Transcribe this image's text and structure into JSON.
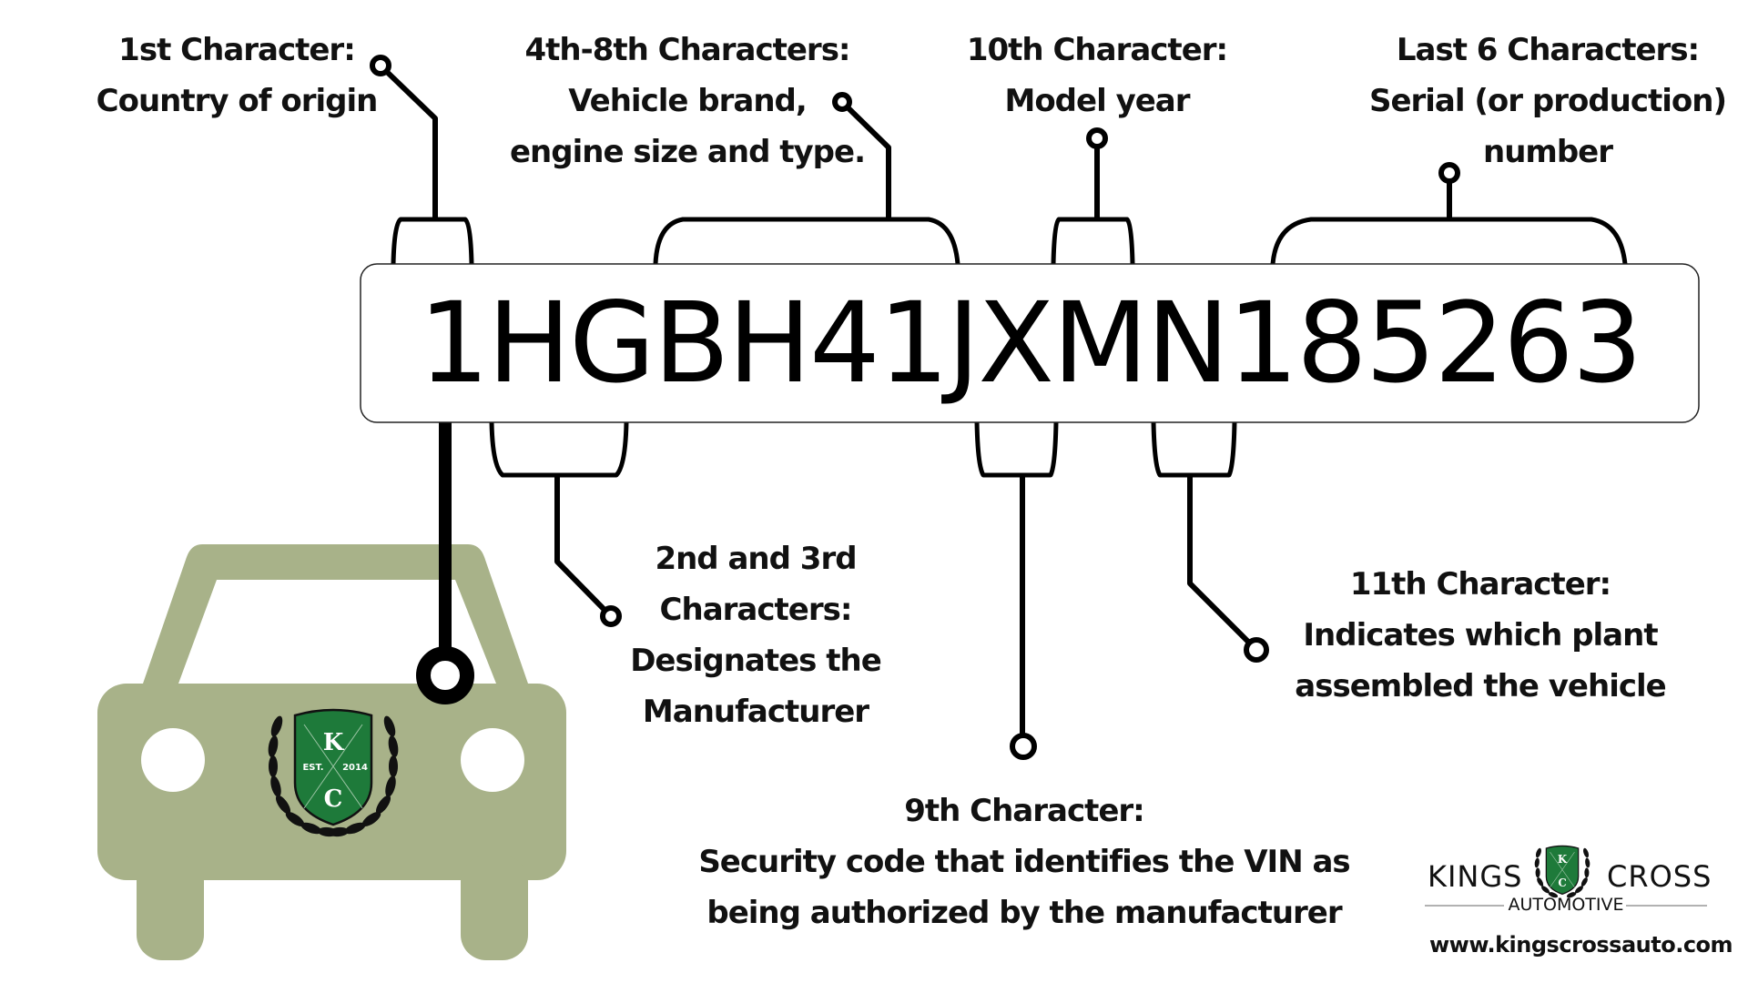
{
  "vin": "1HGBH41JXMN185263",
  "colors": {
    "car": "#a8b289",
    "shield_green": "#1e7a3a",
    "line": "#000000",
    "background": "#ffffff"
  },
  "annotations": {
    "first": {
      "title": "1st Character:",
      "lines": [
        "Country of origin"
      ]
    },
    "fourth_eighth": {
      "title": "4th-8th Characters:",
      "lines": [
        "Vehicle brand,",
        "engine size and type."
      ]
    },
    "tenth": {
      "title": "10th Character:",
      "lines": [
        "Model year"
      ]
    },
    "last_six": {
      "title": "Last 6 Characters:",
      "lines": [
        "Serial (or production)",
        "number"
      ]
    },
    "second_third": {
      "title": "2nd and 3rd",
      "lines": [
        "Characters:",
        "Designates the",
        "Manufacturer"
      ]
    },
    "ninth": {
      "title": "9th Character:",
      "lines": [
        "Security code that identifies the VIN as",
        "being authorized by the manufacturer"
      ]
    },
    "eleventh": {
      "title": "11th Character:",
      "lines": [
        "Indicates which plant",
        "assembled the vehicle"
      ]
    }
  },
  "badge": {
    "top": "K",
    "bottom": "C",
    "left": "EST.",
    "right": "2014"
  },
  "brand": {
    "word_left": "KINGS",
    "word_right": "CROSS",
    "subtitle": "AUTOMOTIVE",
    "url": "www.kingscrossauto.com"
  }
}
